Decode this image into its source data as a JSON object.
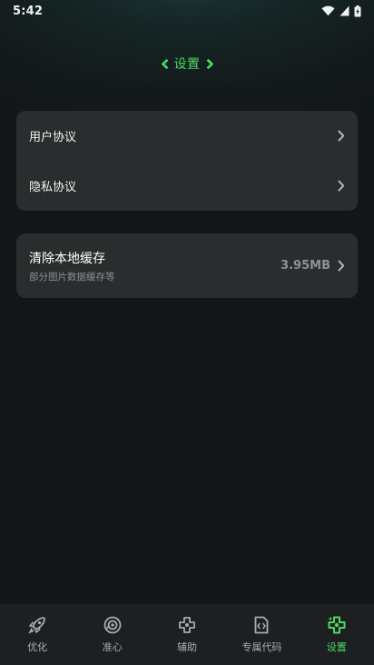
{
  "status_bar": {
    "time": "5:42",
    "icons": [
      "wifi-icon",
      "signal-icon",
      "battery-icon"
    ]
  },
  "header": {
    "title": "设置",
    "accent_color": "#4cd964"
  },
  "settings": {
    "agreements": [
      {
        "label": "用户协议",
        "icon": "chevron-right-icon"
      },
      {
        "label": "隐私协议",
        "icon": "chevron-right-icon"
      }
    ],
    "cache": {
      "title": "清除本地缓存",
      "subtitle": "部分图片数据缓存等",
      "size": "3.95MB",
      "icon": "chevron-right-icon"
    }
  },
  "bottom_nav": {
    "items": [
      {
        "label": "优化",
        "icon": "rocket-icon",
        "active": false
      },
      {
        "label": "准心",
        "icon": "crosshair-icon",
        "active": false
      },
      {
        "label": "辅助",
        "icon": "gamepad-icon",
        "active": false
      },
      {
        "label": "专属代码",
        "icon": "code-file-icon",
        "active": false
      },
      {
        "label": "设置",
        "icon": "settings-gamepad-icon",
        "active": true
      }
    ]
  }
}
